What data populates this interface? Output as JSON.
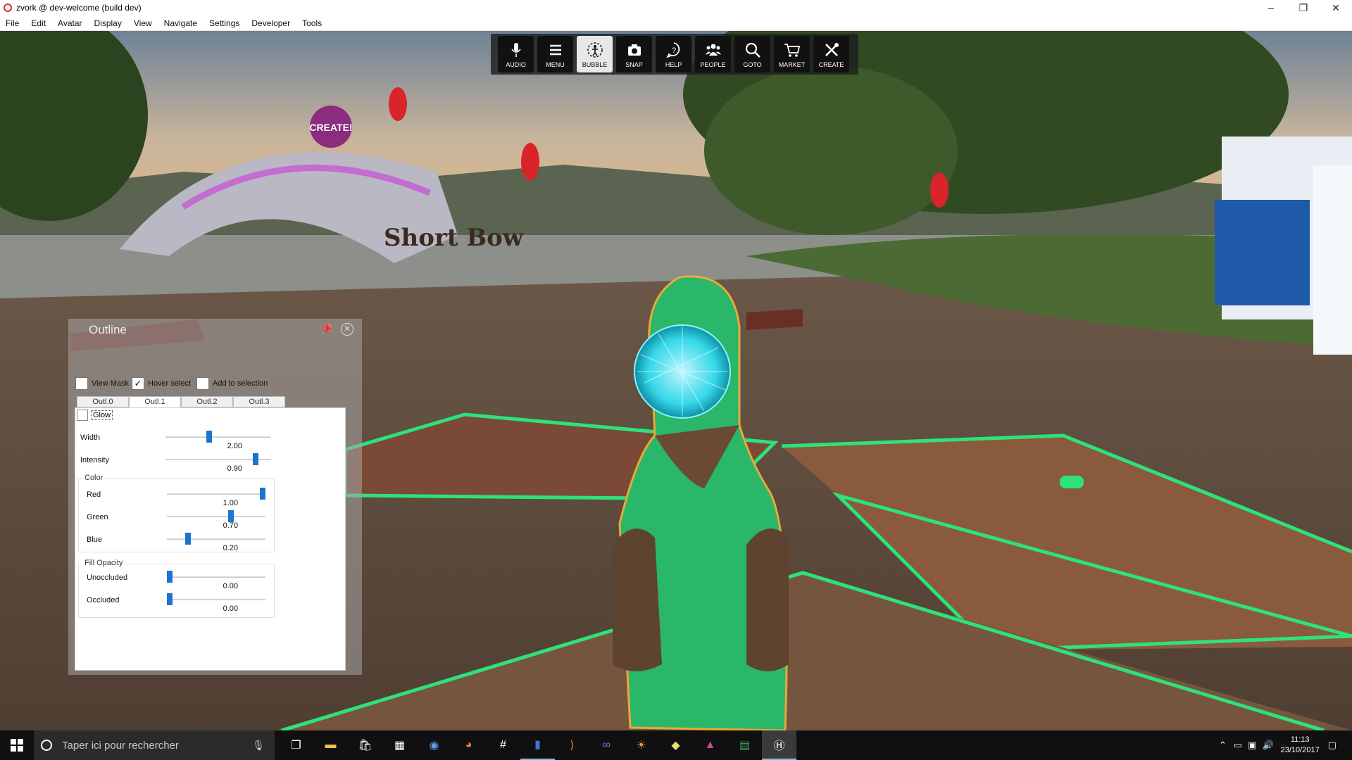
{
  "window": {
    "title": "zvork @ dev-welcome (build dev)",
    "controls": [
      "–",
      "❐",
      "✕"
    ]
  },
  "menubar": [
    "File",
    "Edit",
    "Avatar",
    "Display",
    "View",
    "Navigate",
    "Settings",
    "Developer",
    "Tools"
  ],
  "toolbar": [
    {
      "label": "AUDIO",
      "icon": "microphone-icon",
      "active": false
    },
    {
      "label": "MENU",
      "icon": "hamburger-menu-icon",
      "active": false
    },
    {
      "label": "BUBBLE",
      "icon": "bubble-person-icon",
      "active": true
    },
    {
      "label": "SNAP",
      "icon": "camera-icon",
      "active": false
    },
    {
      "label": "HELP",
      "icon": "help-icon",
      "active": false
    },
    {
      "label": "PEOPLE",
      "icon": "people-icon",
      "active": false
    },
    {
      "label": "GOTO",
      "icon": "magnifier-icon",
      "active": false
    },
    {
      "label": "MARKET",
      "icon": "cart-icon",
      "active": false
    },
    {
      "label": "CREATE",
      "icon": "tools-icon",
      "active": false
    }
  ],
  "scene_signs": {
    "create": "CREATE!",
    "short_bow": "Short Bow"
  },
  "outline_panel": {
    "title": "Outline",
    "view_mask": {
      "label": "View Mask",
      "checked": false
    },
    "hover_select": {
      "label": "Hover select",
      "checked": true
    },
    "add_to_selection": {
      "label": "Add to selection",
      "checked": false
    },
    "tabs": [
      "Outl.0",
      "Outl.1",
      "Outl.2",
      "Outl.3"
    ],
    "selected_tab": 1,
    "glow": {
      "label": "Glow",
      "checked": false
    },
    "width": {
      "label": "Width",
      "value": "2.00",
      "fraction": 0.41
    },
    "intensity": {
      "label": "Intensity",
      "value": "0.90",
      "fraction": 0.87
    },
    "color": {
      "title": "Color",
      "red": {
        "label": "Red",
        "value": "1.00",
        "fraction": 1.0
      },
      "green": {
        "label": "Green",
        "value": "0.70",
        "fraction": 0.66
      },
      "blue": {
        "label": "Blue",
        "value": "0.20",
        "fraction": 0.2
      }
    },
    "fill_opacity": {
      "title": "Fill Opacity",
      "unoccluded": {
        "label": "Unoccluded",
        "value": "0.00",
        "fraction": 0.0
      },
      "occluded": {
        "label": "Occluded",
        "value": "0.00",
        "fraction": 0.0
      }
    }
  },
  "taskbar": {
    "search_placeholder": "Taper ici pour rechercher",
    "apps": [
      "task-view-icon",
      "file-explorer-icon",
      "store-icon",
      "calculator-icon",
      "chrome-icon",
      "firefox-icon",
      "slack-icon",
      "app-blue-icon",
      "visual-studio-code-icon",
      "visual-studio-icon",
      "sun-app-icon",
      "git-icon",
      "triangle-app-icon",
      "spreadsheet-icon",
      "highfidelity-icon"
    ],
    "time": "11:13",
    "date": "23/10/2017"
  },
  "colors": {
    "outline_green": "#2ee27a",
    "slider_blue": "#1b75d0",
    "outline_orange": "#e9a93a"
  }
}
